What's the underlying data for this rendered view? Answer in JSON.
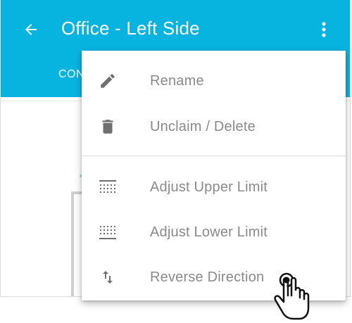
{
  "header": {
    "title": "Office - Left Side",
    "tab_partial": "CON",
    "background_color": "#07b4e0"
  },
  "menu": {
    "items": [
      {
        "label": "Rename",
        "icon": "pencil-icon"
      },
      {
        "label": "Unclaim / Delete",
        "icon": "trash-icon"
      },
      {
        "label": "Adjust Upper Limit",
        "icon": "upper-limit-icon"
      },
      {
        "label": "Adjust Lower Limit",
        "icon": "lower-limit-icon"
      },
      {
        "label": "Reverse Direction",
        "icon": "swap-vertical-icon"
      }
    ]
  },
  "icons": {
    "back": "arrow-left-icon",
    "overflow": "more-vertical-icon",
    "pointer": "tap-hand-icon"
  }
}
